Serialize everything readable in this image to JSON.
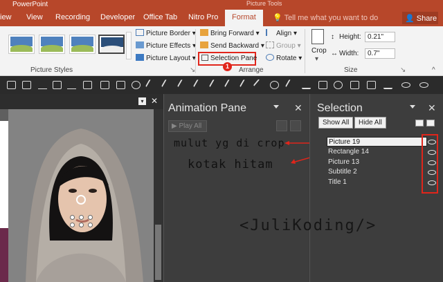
{
  "app": {
    "title": "PowerPoint",
    "context_title": "Picture Tools"
  },
  "tabs": [
    {
      "label": "iew"
    },
    {
      "label": "View"
    },
    {
      "label": "Recording"
    },
    {
      "label": "Developer"
    },
    {
      "label": "Office Tab"
    },
    {
      "label": "Nitro Pro"
    },
    {
      "label": "Format"
    }
  ],
  "tell_me": "Tell me what you want to do",
  "share_label": "Share",
  "ribbon": {
    "picture_styles_label": "Picture Styles",
    "picture_border": "Picture Border",
    "picture_effects": "Picture Effects",
    "picture_layout": "Picture Layout",
    "bring_forward": "Bring Forward",
    "send_backward": "Send Backward",
    "selection_pane": "Selection Pane",
    "align": "Align",
    "group": "Group",
    "rotate": "Rotate",
    "arrange_label": "Arrange",
    "crop": "Crop",
    "height_label": "Height:",
    "height_value": "0.21\"",
    "width_label": "Width:",
    "width_value": "0.7\"",
    "size_label": "Size",
    "step_badge": "1"
  },
  "animation_pane": {
    "title": "Animation Pane",
    "play_all": "Play All",
    "note_1": "mulut yg di crop",
    "note_2": "kotak hitam"
  },
  "selection_pane": {
    "title": "Selection",
    "show_all": "Show All",
    "hide_all": "Hide All",
    "items": [
      {
        "label": "Picture 19"
      },
      {
        "label": "Rectangle 14"
      },
      {
        "label": "Picture 13"
      },
      {
        "label": "Subtitle 2"
      },
      {
        "label": "Title 1"
      }
    ]
  },
  "watermark": "<JuliKoding/>",
  "colors": {
    "accent": "#b7472a",
    "highlight": "#e1251b"
  }
}
